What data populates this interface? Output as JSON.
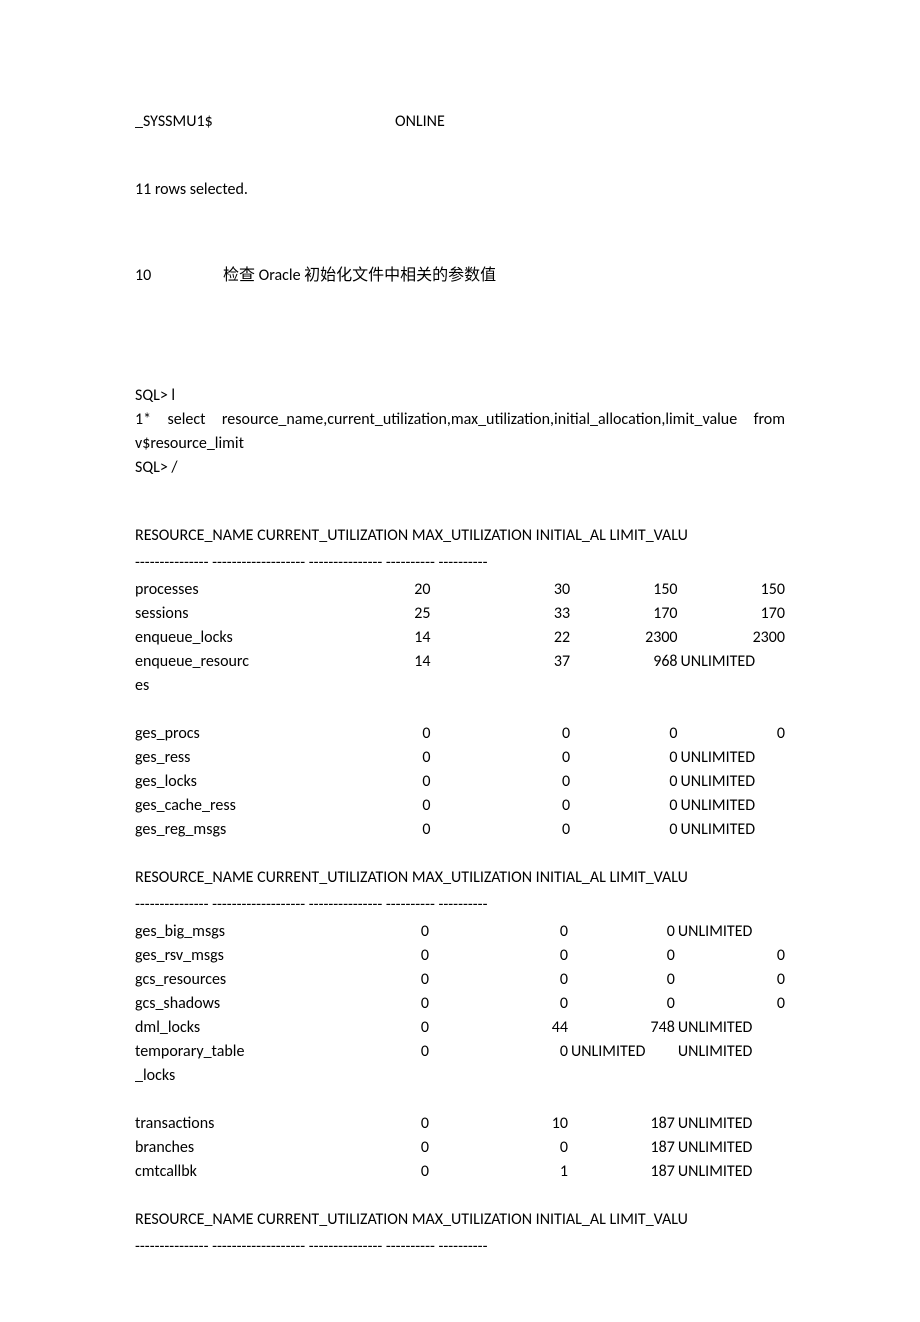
{
  "header_segment": {
    "name": "_SYSSMU1$",
    "status": "ONLINE"
  },
  "rows_selected": "11 rows selected.",
  "section": {
    "number": "10",
    "title": "检查 Oracle 初始化文件中相关的参数值"
  },
  "query": {
    "prompt1": "SQL> l",
    "line1": "1*  select  resource_name,current_utilization,max_utilization,initial_allocation,limit_value  from v$resource_limit",
    "prompt2": "SQL> /"
  },
  "table_header": "RESOURCE_NAME      CURRENT_UTILIZATION MAX_UTILIZATION INITIAL_AL LIMIT_VALU",
  "divider": "--------------- ------------------- --------------- ---------- ----------",
  "block1": [
    {
      "name": "processes",
      "cur": "20",
      "max": "30",
      "init": "150",
      "lim": "150"
    },
    {
      "name": "sessions",
      "cur": "25",
      "max": "33",
      "init": "170",
      "lim": "170"
    },
    {
      "name": "enqueue_locks",
      "cur": "14",
      "max": "22",
      "init": "2300",
      "lim": "2300"
    },
    {
      "name": "enqueue_resources",
      "cur": "14",
      "max": "37",
      "init": "968",
      "lim": "UNLIMITED"
    }
  ],
  "block1_name3_line1": "enqueue_resourc",
  "block1_name3_line2": "es",
  "block2": [
    {
      "name": "ges_procs",
      "cur": "0",
      "max": "0",
      "init": "0",
      "lim": "0"
    },
    {
      "name": "ges_ress",
      "cur": "0",
      "max": "0",
      "init": "0",
      "lim": "UNLIMITED"
    },
    {
      "name": "ges_locks",
      "cur": "0",
      "max": "0",
      "init": "0",
      "lim": "UNLIMITED"
    },
    {
      "name": "ges_cache_ress",
      "cur": "0",
      "max": "0",
      "init": "0",
      "lim": "UNLIMITED"
    },
    {
      "name": "ges_reg_msgs",
      "cur": "0",
      "max": "0",
      "init": "0",
      "lim": "UNLIMITED"
    }
  ],
  "block3": [
    {
      "name": "ges_big_msgs",
      "cur": "0",
      "max": "0",
      "init": "0",
      "lim": "UNLIMITED"
    },
    {
      "name": "ges_rsv_msgs",
      "cur": "0",
      "max": "0",
      "init": "0",
      "lim": "0"
    },
    {
      "name": "gcs_resources",
      "cur": "0",
      "max": "0",
      "init": "0",
      "lim": "0"
    },
    {
      "name": "gcs_shadows",
      "cur": "0",
      "max": "0",
      "init": "0",
      "lim": "0"
    },
    {
      "name": "dml_locks",
      "cur": "0",
      "max": "44",
      "init": "748",
      "lim": "UNLIMITED"
    },
    {
      "name": "temporary_table_locks",
      "cur": "0",
      "max": "0",
      "init": "UNLIMITED",
      "lim": "UNLIMITED"
    }
  ],
  "block3_name5_line1": "temporary_table",
  "block3_name5_line2": "_locks",
  "block4": [
    {
      "name": "transactions",
      "cur": "0",
      "max": "10",
      "init": "187",
      "lim": "UNLIMITED"
    },
    {
      "name": "branches",
      "cur": "0",
      "max": "0",
      "init": "187",
      "lim": "UNLIMITED"
    },
    {
      "name": "cmtcallbk",
      "cur": "0",
      "max": "1",
      "init": "187",
      "lim": "UNLIMITED"
    }
  ]
}
